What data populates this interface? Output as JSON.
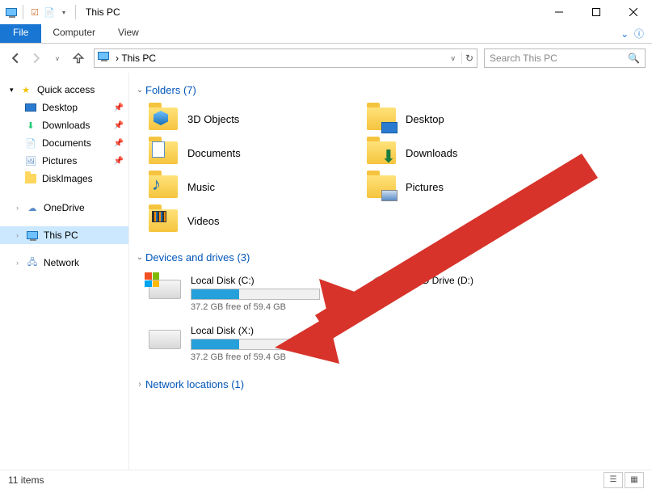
{
  "window": {
    "title": "This PC"
  },
  "ribbon": {
    "file": "File",
    "tabs": [
      "Computer",
      "View"
    ]
  },
  "navbar": {
    "path": "This PC",
    "search_placeholder": "Search This PC"
  },
  "sidebar": {
    "quick_access": {
      "label": "Quick access",
      "items": [
        {
          "label": "Desktop",
          "pinned": true,
          "icon": "desktop"
        },
        {
          "label": "Downloads",
          "pinned": true,
          "icon": "downloads"
        },
        {
          "label": "Documents",
          "pinned": true,
          "icon": "documents"
        },
        {
          "label": "Pictures",
          "pinned": true,
          "icon": "pictures"
        },
        {
          "label": "DiskImages",
          "pinned": false,
          "icon": "folder"
        }
      ]
    },
    "onedrive": {
      "label": "OneDrive"
    },
    "thispc": {
      "label": "This PC"
    },
    "network": {
      "label": "Network"
    }
  },
  "content": {
    "folders_header": "Folders (7)",
    "folders": [
      {
        "label": "3D Objects",
        "badge": "3d"
      },
      {
        "label": "Desktop",
        "badge": "desktop"
      },
      {
        "label": "Documents",
        "badge": "documents"
      },
      {
        "label": "Downloads",
        "badge": "downloads"
      },
      {
        "label": "Music",
        "badge": "music"
      },
      {
        "label": "Pictures",
        "badge": "pictures"
      },
      {
        "label": "Videos",
        "badge": "videos"
      }
    ],
    "drives_header": "Devices and drives (3)",
    "drives": [
      {
        "label": "Local Disk (C:)",
        "free": "37.2 GB free of 59.4 GB",
        "used_frac": 0.374,
        "icon": "hdd-windows"
      },
      {
        "label": "DVD Drive (D:)",
        "icon": "dvd"
      },
      {
        "label": "Local Disk (X:)",
        "free": "37.2 GB free of 59.4 GB",
        "used_frac": 0.374,
        "icon": "hdd"
      }
    ],
    "network_header": "Network locations (1)"
  },
  "status": {
    "items": "11 items"
  }
}
